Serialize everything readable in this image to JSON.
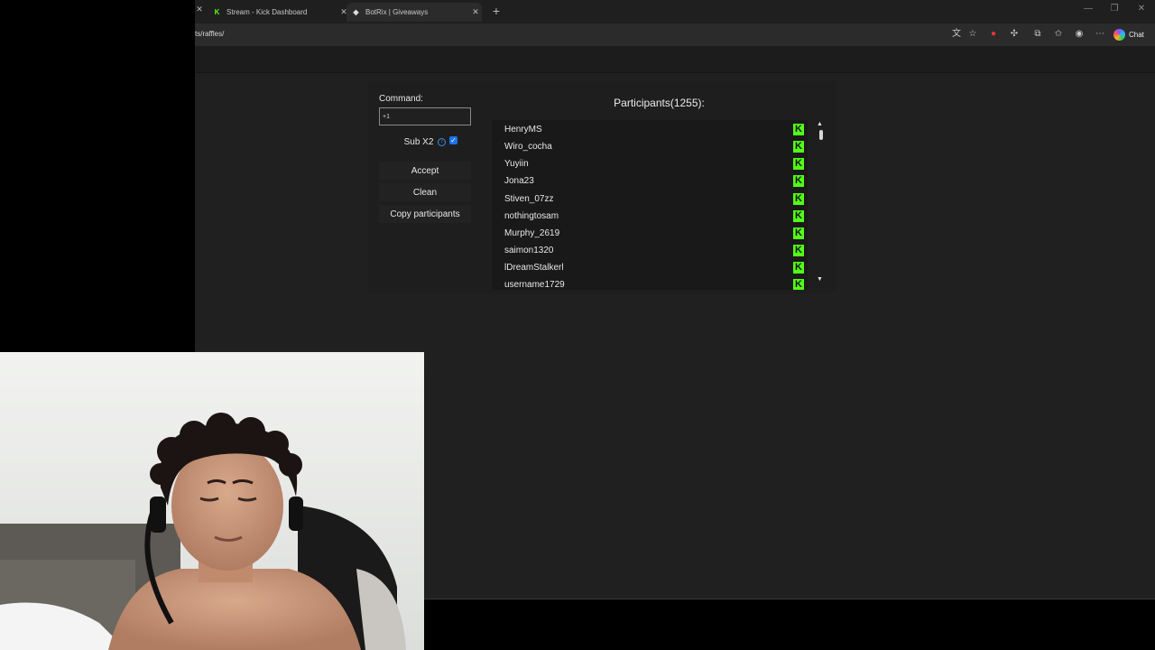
{
  "browser": {
    "tabs": [
      {
        "label": "Stream - Kick Dashboard",
        "favicon": "kick-logo-icon"
      },
      {
        "label": "BotRix | Giveaways",
        "favicon": "botrix-logo-icon",
        "active": true
      }
    ],
    "url": "ts/raffles/",
    "chat_label": "Chat"
  },
  "raffle": {
    "command_label": "Command:",
    "command_value": "+1",
    "sub_label": "Sub X2",
    "sub_checked": true,
    "accept_label": "Accept",
    "clean_label": "Clean",
    "copy_label": "Copy participants",
    "participants_title": "Participants(1255):",
    "participants": [
      "HenryMS",
      "Wiro_cocha",
      "Yuyiin",
      "Jona23",
      "Stiven_07zz",
      "nothingtosam",
      "Murphy_2619",
      "saimon1320",
      "lDreamStalkerl",
      "username1729"
    ],
    "platform_badge": "K"
  },
  "colors": {
    "kick_green": "#53fc18",
    "checkbox_blue": "#1a73e8",
    "page_bg": "#202020"
  }
}
